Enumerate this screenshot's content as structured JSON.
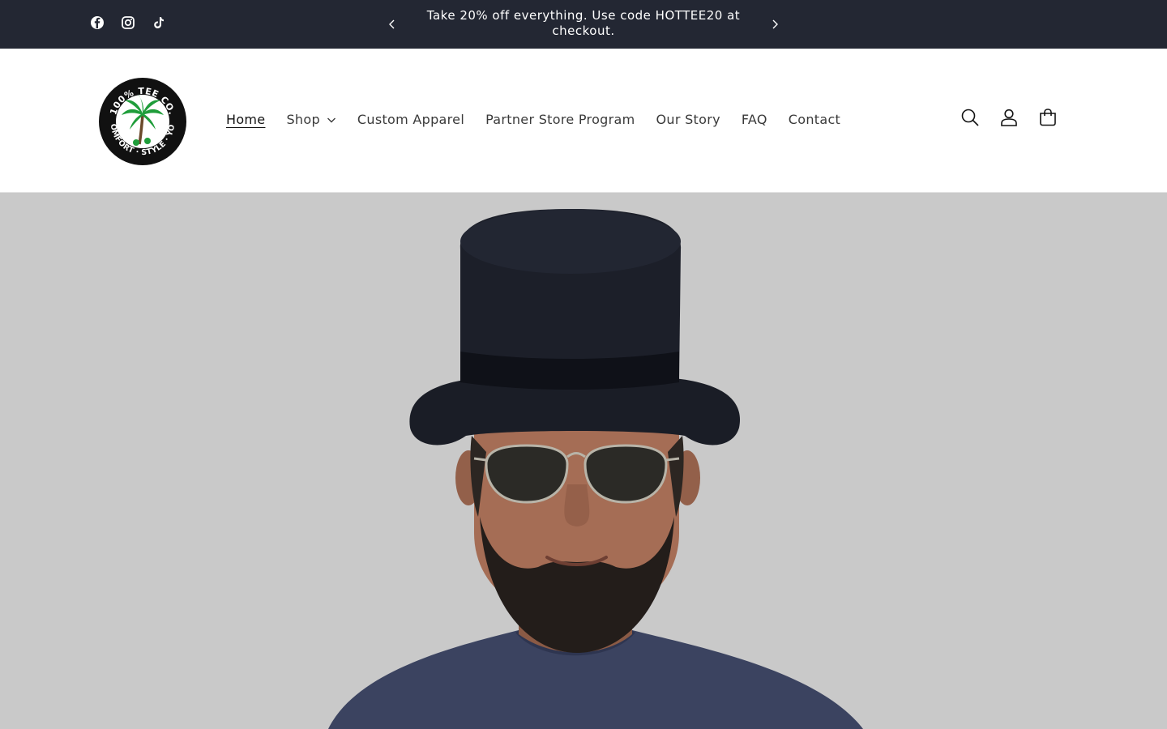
{
  "announcement": {
    "text": "Take 20% off everything. Use code HOTTEE20 at checkout.",
    "social": [
      {
        "name": "facebook-icon"
      },
      {
        "name": "instagram-icon"
      },
      {
        "name": "tiktok-icon"
      }
    ]
  },
  "logo": {
    "top_text": "100% TEE CO.",
    "bottom_text": "COMFORT · STYLE · YOU"
  },
  "nav": {
    "items": [
      {
        "label": "Home",
        "active": true
      },
      {
        "label": "Shop",
        "has_dropdown": true
      },
      {
        "label": "Custom Apparel"
      },
      {
        "label": "Partner Store Program"
      },
      {
        "label": "Our Story"
      },
      {
        "label": "FAQ"
      },
      {
        "label": "Contact"
      }
    ]
  },
  "header_icons": [
    "search-icon",
    "account-icon",
    "cart-icon"
  ],
  "colors": {
    "announcement_bg": "#232733",
    "hero_bg": "#c9c9c9",
    "text": "#3a3a3a"
  }
}
